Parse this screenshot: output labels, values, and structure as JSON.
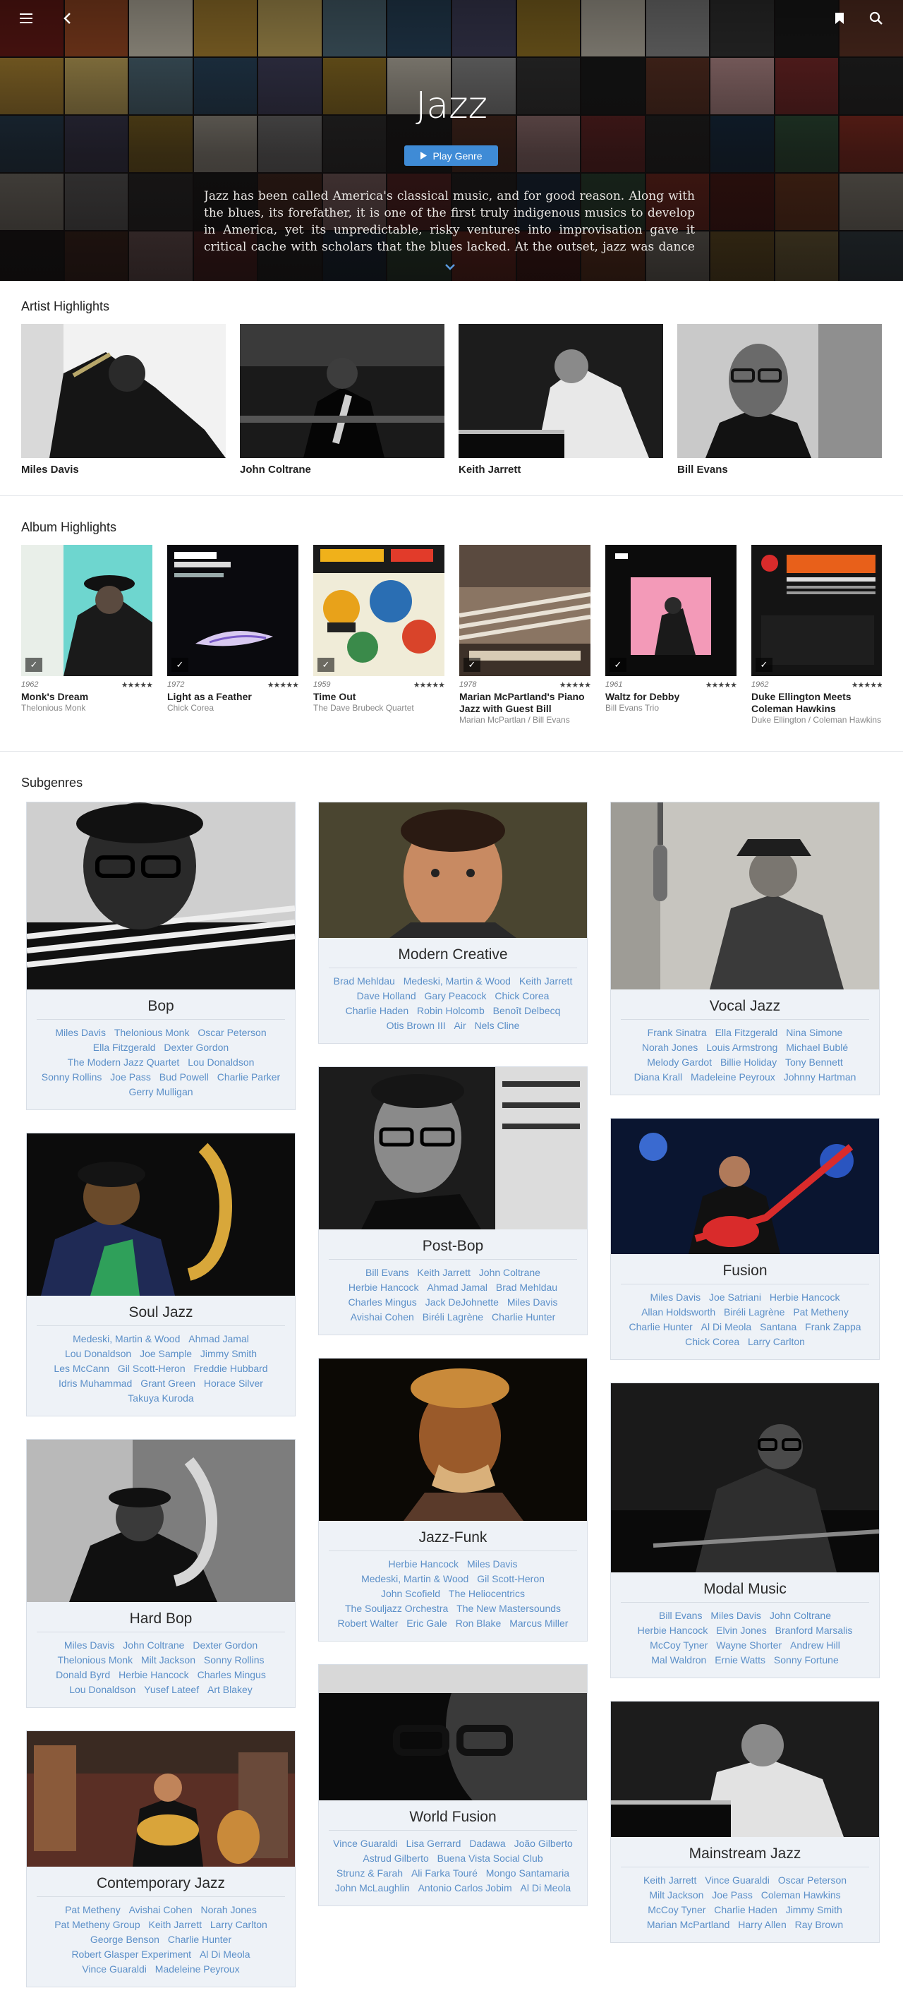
{
  "hero": {
    "title": "Jazz",
    "play_label": "Play Genre",
    "description": "Jazz has been called America's classical music, and for good reason. Along with the blues, its forefather, it is one of the first truly indigenous musics to develop in America, yet its unpredictable, risky ventures into improvisation gave it critical cache with scholars that the blues lacked. At the outset, jazz was dance music,",
    "icons": {
      "menu": "menu-icon",
      "back": "back-arrow-icon",
      "bookmark": "bookmark-icon",
      "search": "search-icon",
      "expand": "chevron-down-icon"
    },
    "accent": "#3f8bd6"
  },
  "artist_highlights": {
    "title": "Artist Highlights",
    "items": [
      {
        "name": "Miles Davis"
      },
      {
        "name": "John Coltrane"
      },
      {
        "name": "Keith Jarrett"
      },
      {
        "name": "Bill Evans"
      }
    ]
  },
  "album_highlights": {
    "title": "Album Highlights",
    "items": [
      {
        "year": "1962",
        "rating": "★★★★★",
        "title": "Monk's Dream",
        "artist": "Thelonious Monk"
      },
      {
        "year": "1972",
        "rating": "★★★★★",
        "title": "Light as a Feather",
        "artist": "Chick Corea"
      },
      {
        "year": "1959",
        "rating": "★★★★★",
        "title": "Time Out",
        "artist": "The Dave Brubeck Quartet"
      },
      {
        "year": "1978",
        "rating": "★★★★★",
        "title": "Marian McPartland's Piano Jazz with Guest Bill",
        "artist": "Marian McPartlan / Bill Evans"
      },
      {
        "year": "1961",
        "rating": "★★★★★",
        "title": "Waltz for Debby",
        "artist": "Bill Evans Trio"
      },
      {
        "year": "1962",
        "rating": "★★★★★",
        "title": "Duke Ellington Meets Coleman Hawkins",
        "artist": "Duke Ellington / Coleman Hawkins"
      }
    ]
  },
  "subgenres": {
    "title": "Subgenres",
    "items": [
      {
        "name": "Bop",
        "artists": [
          "Miles Davis",
          "Thelonious Monk",
          "Oscar Peterson",
          "Ella Fitzgerald",
          "Dexter Gordon",
          "The Modern Jazz Quartet",
          "Lou Donaldson",
          "Sonny Rollins",
          "Joe Pass",
          "Bud Powell",
          "Charlie Parker",
          "Gerry Mulligan"
        ]
      },
      {
        "name": "Soul Jazz",
        "artists": [
          "Medeski, Martin & Wood",
          "Ahmad Jamal",
          "Lou Donaldson",
          "Joe Sample",
          "Jimmy Smith",
          "Les McCann",
          "Gil Scott-Heron",
          "Freddie Hubbard",
          "Idris Muhammad",
          "Grant Green",
          "Horace Silver",
          "Takuya Kuroda"
        ]
      },
      {
        "name": "Hard Bop",
        "artists": [
          "Miles Davis",
          "John Coltrane",
          "Dexter Gordon",
          "Thelonious Monk",
          "Milt Jackson",
          "Sonny Rollins",
          "Donald Byrd",
          "Herbie Hancock",
          "Charles Mingus",
          "Lou Donaldson",
          "Yusef Lateef",
          "Art Blakey"
        ]
      },
      {
        "name": "Contemporary Jazz",
        "artists": [
          "Pat Metheny",
          "Avishai Cohen",
          "Norah Jones",
          "Pat Metheny Group",
          "Keith Jarrett",
          "Larry Carlton",
          "George Benson",
          "Charlie Hunter",
          "Robert Glasper Experiment",
          "Al Di Meola",
          "Vince Guaraldi",
          "Madeleine Peyroux"
        ]
      },
      {
        "name": "Modern Creative",
        "artists": [
          "Brad Mehldau",
          "Medeski, Martin & Wood",
          "Keith Jarrett",
          "Dave Holland",
          "Gary Peacock",
          "Chick Corea",
          "Charlie Haden",
          "Robin Holcomb",
          "Benoît Delbecq",
          "Otis Brown III",
          "Air",
          "Nels Cline"
        ]
      },
      {
        "name": "Post-Bop",
        "artists": [
          "Bill Evans",
          "Keith Jarrett",
          "John Coltrane",
          "Herbie Hancock",
          "Ahmad Jamal",
          "Brad Mehldau",
          "Charles Mingus",
          "Jack DeJohnette",
          "Miles Davis",
          "Avishai Cohen",
          "Biréli Lagrène",
          "Charlie Hunter"
        ]
      },
      {
        "name": "Jazz-Funk",
        "artists": [
          "Herbie Hancock",
          "Miles Davis",
          "Medeski, Martin & Wood",
          "Gil Scott-Heron",
          "John Scofield",
          "The Heliocentrics",
          "The Souljazz Orchestra",
          "The New Mastersounds",
          "Robert Walter",
          "Eric Gale",
          "Ron Blake",
          "Marcus Miller"
        ]
      },
      {
        "name": "World Fusion",
        "artists": [
          "Vince Guaraldi",
          "Lisa Gerrard",
          "Dadawa",
          "João Gilberto",
          "Astrud Gilberto",
          "Buena Vista Social Club",
          "Strunz & Farah",
          "Ali Farka Touré",
          "Mongo Santamaria",
          "John McLaughlin",
          "Antonio Carlos Jobim",
          "Al Di Meola"
        ]
      },
      {
        "name": "Vocal Jazz",
        "artists": [
          "Frank Sinatra",
          "Ella Fitzgerald",
          "Nina Simone",
          "Norah Jones",
          "Louis Armstrong",
          "Michael Bublé",
          "Melody Gardot",
          "Billie Holiday",
          "Tony Bennett",
          "Diana Krall",
          "Madeleine Peyroux",
          "Johnny Hartman"
        ]
      },
      {
        "name": "Fusion",
        "artists": [
          "Miles Davis",
          "Joe Satriani",
          "Herbie Hancock",
          "Allan Holdsworth",
          "Biréli Lagrène",
          "Pat Metheny",
          "Charlie Hunter",
          "Al Di Meola",
          "Santana",
          "Frank Zappa",
          "Chick Corea",
          "Larry Carlton"
        ]
      },
      {
        "name": "Modal Music",
        "artists": [
          "Bill Evans",
          "Miles Davis",
          "John Coltrane",
          "Herbie Hancock",
          "Elvin Jones",
          "Branford Marsalis",
          "McCoy Tyner",
          "Wayne Shorter",
          "Andrew Hill",
          "Mal Waldron",
          "Ernie Watts",
          "Sonny Fortune"
        ]
      },
      {
        "name": "Mainstream Jazz",
        "artists": [
          "Keith Jarrett",
          "Vince Guaraldi",
          "Oscar Peterson",
          "Milt Jackson",
          "Joe Pass",
          "Coleman Hawkins",
          "McCoy Tyner",
          "Charlie Haden",
          "Jimmy Smith",
          "Marian McPartland",
          "Harry Allen",
          "Ray Brown"
        ]
      }
    ]
  },
  "colors": {
    "link": "#5b8fc8",
    "card_bg": "#eef2f7",
    "hero_bg": "#1a1516"
  }
}
